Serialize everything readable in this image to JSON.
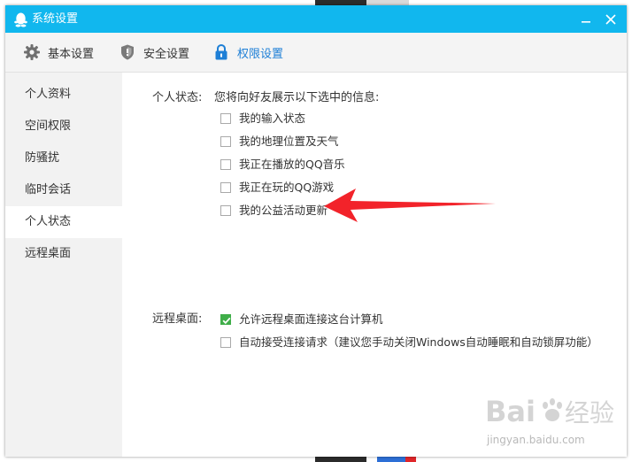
{
  "window": {
    "title": "系统设置",
    "accent_color": "#11b7ee",
    "title_icon": "qq-penguin-icon",
    "minimize_icon": "minimize-icon",
    "close_icon": "close-icon"
  },
  "tabs": [
    {
      "label": "基本设置",
      "icon": "gear-icon",
      "active": false
    },
    {
      "label": "安全设置",
      "icon": "shield-icon",
      "active": false
    },
    {
      "label": "权限设置",
      "icon": "lock-icon",
      "active": true
    }
  ],
  "sidebar": {
    "items": [
      {
        "label": "个人资料",
        "active": false
      },
      {
        "label": "空间权限",
        "active": false
      },
      {
        "label": "防骚扰",
        "active": false
      },
      {
        "label": "临时会话",
        "active": false
      },
      {
        "label": "个人状态",
        "active": true
      },
      {
        "label": "远程桌面",
        "active": false
      }
    ]
  },
  "personal_status": {
    "label": "个人状态:",
    "description": "您将向好友展示以下选中的信息:",
    "options": [
      {
        "label": "我的输入状态",
        "checked": false
      },
      {
        "label": "我的地理位置及天气",
        "checked": false
      },
      {
        "label": "我正在播放的QQ音乐",
        "checked": false
      },
      {
        "label": "我正在玩的QQ游戏",
        "checked": false
      },
      {
        "label": "我的公益活动更新",
        "checked": false
      }
    ]
  },
  "remote_desktop": {
    "label": "远程桌面:",
    "options": [
      {
        "label": "允许远程桌面连接这台计算机",
        "checked": true
      },
      {
        "label": "自动接受连接请求（建议您手动关闭Windows自动睡眠和自动锁屏功能）",
        "checked": false
      }
    ]
  },
  "annotation": {
    "arrow_color": "#f2232a"
  },
  "watermark": {
    "brand": "Bai du 经验",
    "url": "jingyan.baidu.com"
  },
  "colors": {
    "active_tab": "#1e7fd6",
    "checkbox_checked": "#3fae49"
  }
}
